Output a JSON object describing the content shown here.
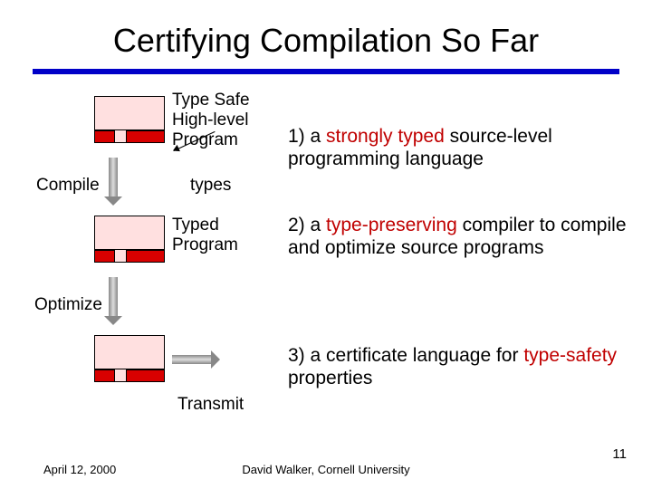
{
  "title": "Certifying Compilation So Far",
  "box1_label": "Type Safe\nHigh-level\nProgram",
  "compile_label": "Compile",
  "types_label": "types",
  "box2_label": "Typed\nProgram",
  "optimize_label": "Optimize",
  "transmit_label": "Transmit",
  "point1_pre": "1) a ",
  "point1_red": "strongly typed",
  "point1_post": " source-level programming language",
  "point2_pre": "2) a ",
  "point2_red": "type-preserving",
  "point2_post": " compiler to compile and optimize source programs",
  "point3_pre": "3) a certificate language for ",
  "point3_red": "type-safety",
  "point3_post": " properties",
  "footer_date": "April 12, 2000",
  "footer_center": "David Walker, Cornell University",
  "footer_num": "11"
}
